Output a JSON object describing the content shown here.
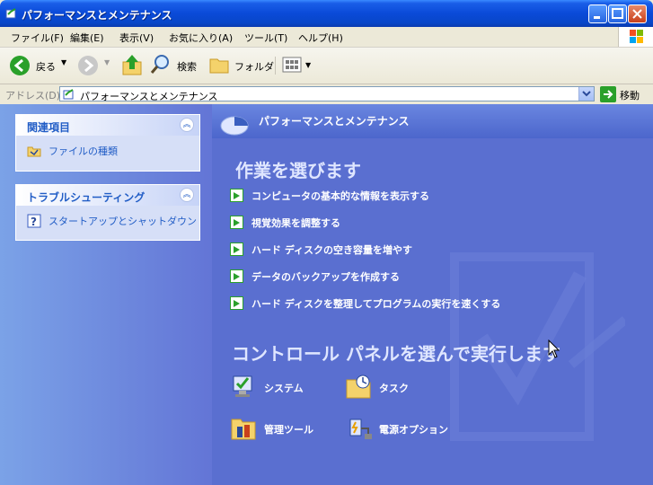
{
  "window": {
    "title": "パフォーマンスとメンテナンス"
  },
  "menu": [
    "ファイル(F)",
    "編集(E)",
    "表示(V)",
    "お気に入り(A)",
    "ツール(T)",
    "ヘルプ(H)"
  ],
  "toolbar": {
    "back_label": "戻る",
    "search_label": "検索",
    "folders_label": "フォルダ"
  },
  "address": {
    "label": "アドレス(D)",
    "value": "パフォーマンスとメンテナンス",
    "go_label": "移動"
  },
  "sidebar": {
    "related": {
      "title": "関連項目",
      "items": [
        "ファイルの種類"
      ]
    },
    "troubleshoot": {
      "title": "トラブルシューティング",
      "items": [
        "スタートアップとシャットダウン"
      ]
    }
  },
  "main": {
    "header_title": "パフォーマンスとメンテナンス",
    "tasks_heading": "作業を選びます",
    "tasks": [
      "コンピュータの基本的な情報を表示する",
      "視覚効果を調整する",
      "ハード ディスクの空き容量を増やす",
      "データのバックアップを作成する",
      "ハード ディスクを整理してプログラムの実行を速くする"
    ],
    "cp_heading": "コントロール パネルを選んで実行します",
    "cp_items": [
      "システム",
      "タスク",
      "管理ツール",
      "電源オプション"
    ]
  },
  "colors": {
    "title_bar": "#0a4ad8",
    "main_bg": "#5a6fd0",
    "sidebar_bg": "#7ba2e7",
    "link": "#215dc6",
    "task_arrow": "#2aa02a"
  }
}
